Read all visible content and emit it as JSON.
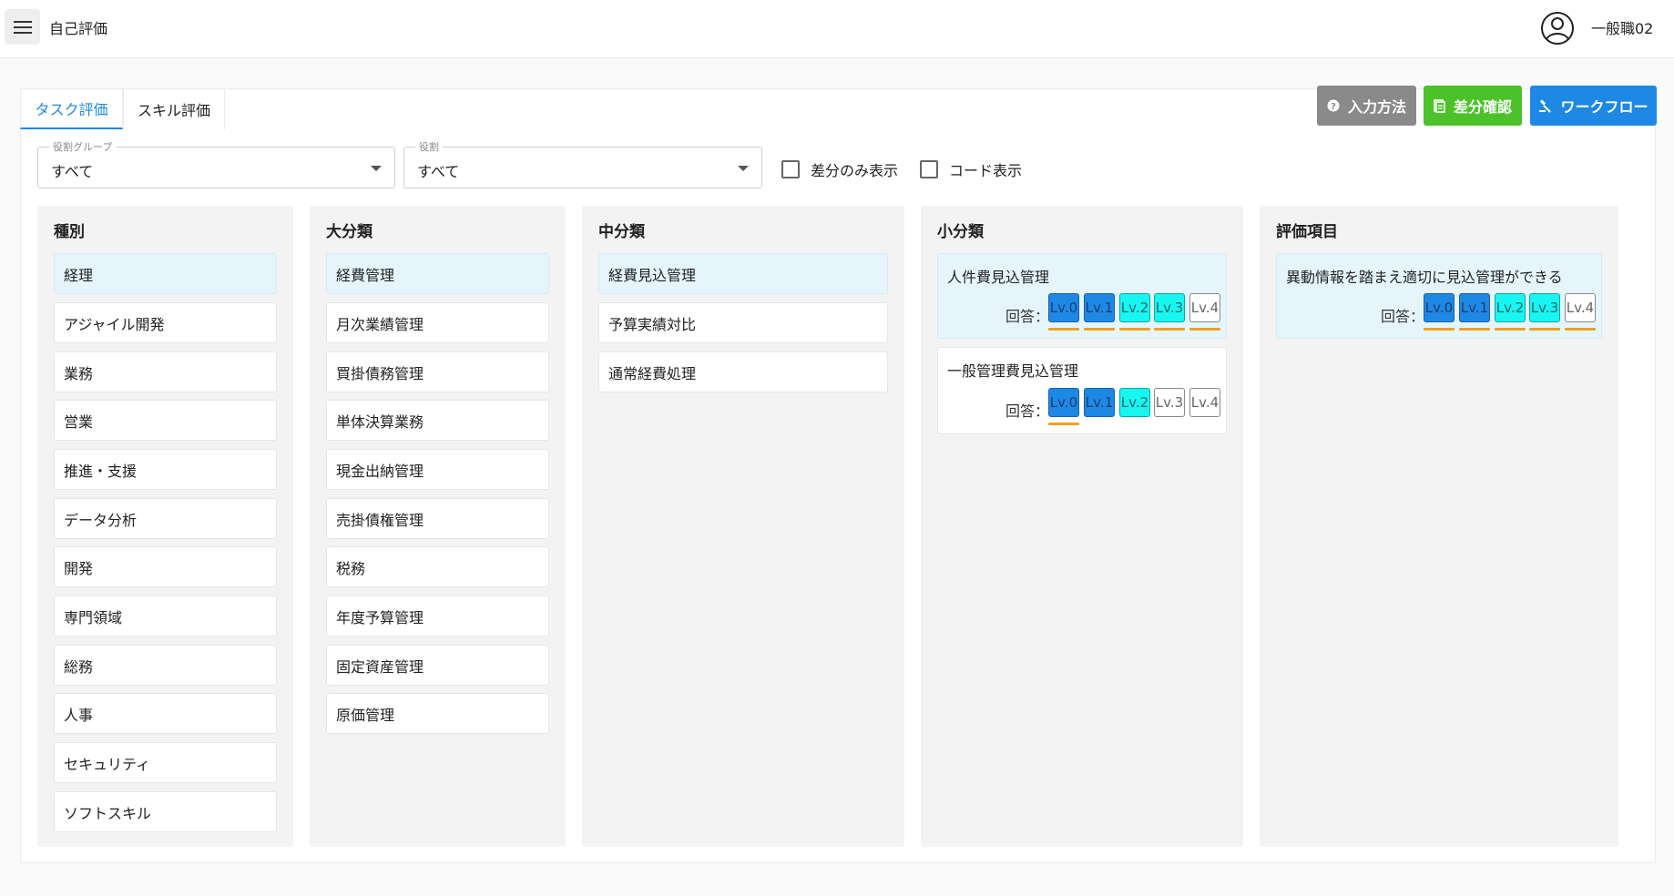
{
  "app": {
    "title": "自己評価",
    "user_name": "一般職02"
  },
  "tabs": [
    {
      "label": "タスク評価",
      "active": true
    },
    {
      "label": "スキル評価",
      "active": false
    }
  ],
  "actions": {
    "input_method": "入力方法",
    "diff_check": "差分確認",
    "workflow": "ワークフロー"
  },
  "filters": {
    "role_group": {
      "label": "役割グループ",
      "value": "すべて"
    },
    "role": {
      "label": "役割",
      "value": "すべて"
    },
    "diff_only": "差分のみ表示",
    "code_display": "コード表示"
  },
  "columns": {
    "kind": {
      "title": "種別",
      "items": [
        "経理",
        "アジャイル開発",
        "業務",
        "営業",
        "推進・支援",
        "データ分析",
        "開発",
        "専門領域",
        "総務",
        "人事",
        "セキュリティ",
        "ソフトスキル"
      ],
      "selected": 0
    },
    "major": {
      "title": "大分類",
      "items": [
        "経費管理",
        "月次業績管理",
        "買掛債務管理",
        "単体決算業務",
        "現金出納管理",
        "売掛債権管理",
        "税務",
        "年度予算管理",
        "固定資産管理",
        "原価管理"
      ],
      "selected": 0
    },
    "middle": {
      "title": "中分類",
      "items": [
        "経費見込管理",
        "予算実績対比",
        "通常経費処理"
      ],
      "selected": 0
    },
    "minor": {
      "title": "小分類",
      "answer_label": "回答：",
      "items": [
        {
          "name": "人件費見込管理",
          "levels": [
            "Lv.0",
            "Lv.1",
            "Lv.2",
            "Lv.3",
            "Lv.4"
          ],
          "answer_level": 4,
          "selected": true
        },
        {
          "name": "一般管理費見込管理",
          "levels": [
            "Lv.0",
            "Lv.1",
            "Lv.2",
            "Lv.3",
            "Lv.4"
          ],
          "answer_level": 2,
          "selected": false
        }
      ]
    },
    "eval": {
      "title": "評価項目",
      "answer_label": "回答：",
      "items": [
        {
          "name": "異動情報を踏まえ適切に見込管理ができる",
          "levels": [
            "Lv.0",
            "Lv.1",
            "Lv.2",
            "Lv.3",
            "Lv.4"
          ],
          "answer_level": 4,
          "selected": true
        }
      ]
    }
  },
  "colors": {
    "primary": "#1e88e5",
    "success": "#4cc22a",
    "neutral": "#8a8a8a",
    "level_dark": "#1e88e5",
    "level_cyan": "#19f5f0",
    "underline": "#f0a020"
  }
}
